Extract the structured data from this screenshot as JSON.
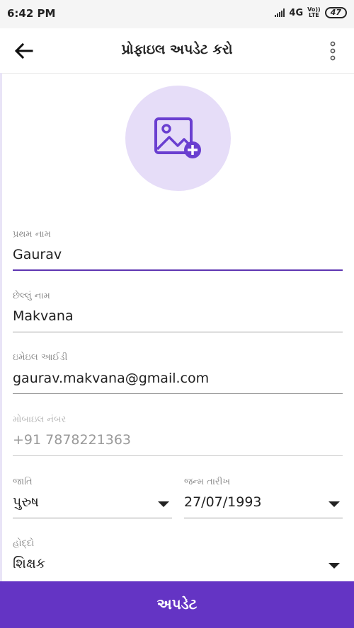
{
  "status_bar": {
    "time": "6:42 PM",
    "network": "4G",
    "volte_top": "Vo))",
    "volte_bottom": "LTE",
    "battery": "47"
  },
  "app_bar": {
    "title": "પ્રોફાઇલ અપડેટ કરો",
    "back_icon": "arrow-left-icon",
    "more_icon": "more-vertical-icon"
  },
  "avatar": {
    "icon": "add-photo-icon"
  },
  "form": {
    "first_name": {
      "label": "પ્રથમ નામ",
      "value": "Gaurav"
    },
    "last_name": {
      "label": "છેલ્લું નામ",
      "value": "Makvana"
    },
    "email": {
      "label": "ઇમેઇલ આઈડી",
      "value": "gaurav.makvana@gmail.com"
    },
    "mobile": {
      "label": "મોબાઇલ નંબર",
      "value": "+91 7878221363"
    },
    "gender": {
      "label": "જાતિ",
      "value": "પુરુષ"
    },
    "dob": {
      "label": "જન્મ તારીખ",
      "value": "27/07/1993"
    },
    "designation": {
      "label": "હોદ્દો",
      "value": "શિક્ષક"
    }
  },
  "actions": {
    "update_label": "અપડેટ"
  },
  "colors": {
    "accent": "#6434c4",
    "avatar_bg": "#e6ddf8",
    "icon": "#6a3fd0"
  }
}
